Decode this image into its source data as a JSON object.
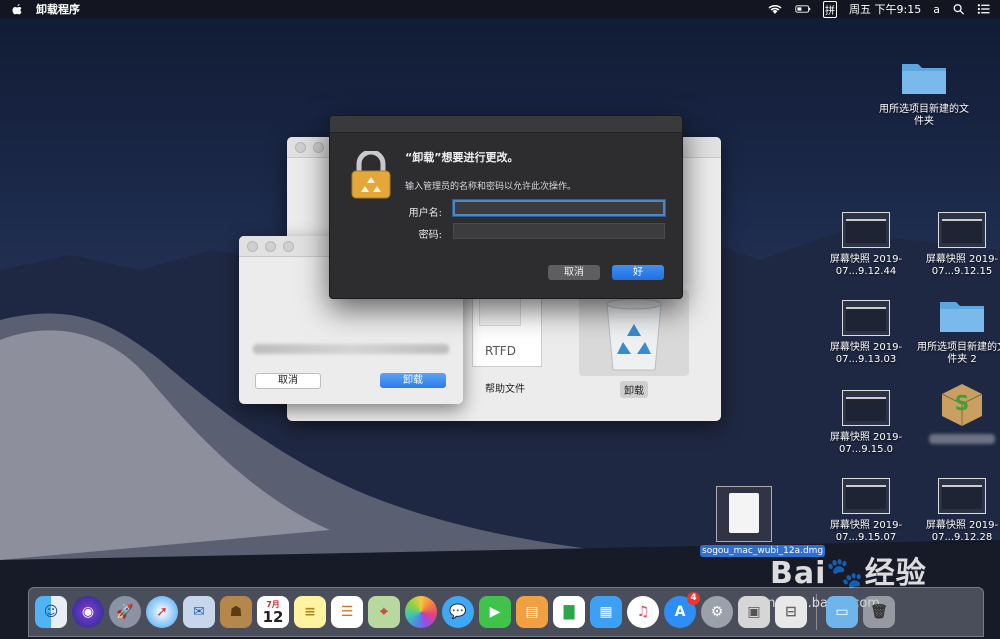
{
  "menubar": {
    "app_name": "卸载程序",
    "clock": "周五 下午9:15",
    "user": "a",
    "input_method": "拼"
  },
  "desktop": {
    "items": [
      {
        "label": "用所选项目新建的文件夹",
        "kind": "folder"
      },
      {
        "label": "屏幕快照 2019-07...9.12.44",
        "kind": "screenshot"
      },
      {
        "label": "屏幕快照 2019-07...9.12.15",
        "kind": "screenshot"
      },
      {
        "label": "屏幕快照 2019-07...9.13.03",
        "kind": "screenshot"
      },
      {
        "label": "用所选项目新建的文件夹 2",
        "kind": "folder"
      },
      {
        "label": "屏幕快照 2019-07...9.15.0",
        "kind": "screenshot"
      },
      {
        "label": "屏幕快照 2019-07...9.15.07",
        "kind": "screenshot"
      },
      {
        "label": "屏幕快照 2019-07...9.12.28",
        "kind": "screenshot"
      },
      {
        "label": "sogou_mac_wubi_12a.dmg",
        "kind": "dmg"
      }
    ]
  },
  "uninstaller_window": {
    "rtfd_tag": "RTFD",
    "help_label": "帮助文件",
    "uninstall_label": "卸载"
  },
  "confirm_window": {
    "cancel_label": "取消",
    "uninstall_label": "卸载"
  },
  "auth_dialog": {
    "title": "“卸载”想要进行更改。",
    "subtitle": "输入管理员的名称和密码以允许此次操作。",
    "username_label": "用户名:",
    "password_label": "密码:",
    "username_value": "",
    "password_value": "",
    "cancel_label": "取消",
    "ok_label": "好"
  },
  "watermark": {
    "brand": "Bai",
    "brand2": "经验",
    "url": "jingyan.baidu.com"
  },
  "dock": {
    "apps": [
      "finder-icon",
      "siri-icon",
      "launchpad-icon",
      "safari-icon",
      "mail-icon",
      "contacts-icon",
      "calendar-icon",
      "notes-icon",
      "reminders-icon",
      "maps-icon",
      "photos-icon",
      "messages-icon",
      "facetime-icon",
      "keynote-icon",
      "numbers-icon",
      "keynote2-icon",
      "music-icon",
      "appstore-icon",
      "preferences-icon",
      "preview-icon",
      "archive-icon",
      "folder-icon",
      "trash-icon"
    ],
    "calendar_month": "7月",
    "calendar_day": "12",
    "appstore_badge": "4"
  }
}
